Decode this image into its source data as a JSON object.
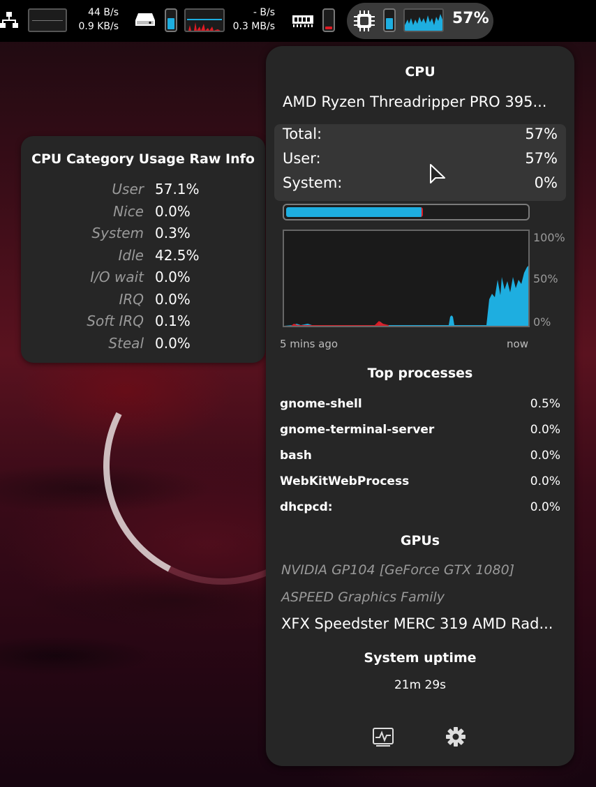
{
  "topbar": {
    "network": {
      "upload": "44  B/s",
      "download": "0.9 KB/s"
    },
    "disk": {
      "read": "- B/s",
      "write": "0.3 MB/s",
      "usage_fraction": 0.6
    },
    "memory": {
      "usage_fraction": 0.15
    },
    "cpu": {
      "percent": "57%",
      "usage_fraction": 0.6
    }
  },
  "raw_info": {
    "title": "CPU Category Usage Raw Info",
    "rows": [
      {
        "key": "User",
        "value": "57.1%"
      },
      {
        "key": "Nice",
        "value": "0.0%"
      },
      {
        "key": "System",
        "value": "0.3%"
      },
      {
        "key": "Idle",
        "value": "42.5%"
      },
      {
        "key": "I/O wait",
        "value": "0.0%"
      },
      {
        "key": "IRQ",
        "value": "0.0%"
      },
      {
        "key": "Soft IRQ",
        "value": "0.1%"
      },
      {
        "key": "Steal",
        "value": "0.0%"
      }
    ]
  },
  "popover": {
    "title": "CPU",
    "cpu_name": "AMD Ryzen Threadripper PRO 395...",
    "stats": [
      {
        "key": "Total:",
        "value": "57%"
      },
      {
        "key": "User:",
        "value": "57%"
      },
      {
        "key": "System:",
        "value": "0%"
      }
    ],
    "usage_fraction": 0.57,
    "graph": {
      "labels": {
        "top": "100%",
        "mid": "50%",
        "bottom": "0%"
      },
      "time_start": "5 mins ago",
      "time_end": "now"
    },
    "top_processes_title": "Top processes",
    "processes": [
      {
        "name": "gnome-shell",
        "percent": "0.5%"
      },
      {
        "name": "gnome-terminal-server",
        "percent": "0.0%"
      },
      {
        "name": "bash",
        "percent": "0.0%"
      },
      {
        "name": "WebKitWebProcess",
        "percent": "0.0%"
      },
      {
        "name": "dhcpcd:",
        "percent": "0.0%"
      }
    ],
    "gpus_title": "GPUs",
    "gpus": [
      "NVIDIA GP104 [GeForce GTX 1080]",
      "ASPEED Graphics Family",
      "XFX Speedster MERC 319 AMD Rad..."
    ],
    "uptime_title": "System uptime",
    "uptime": "21m 29s"
  },
  "colors": {
    "accent_blue": "#1eaee0",
    "accent_red": "#e01b24",
    "panel_bg": "#262626"
  },
  "icons": {
    "network": "network-icon",
    "disk": "disk-icon",
    "memory": "memory-icon",
    "cpu": "cpu-chip-icon",
    "monitor": "system-monitor-icon",
    "settings": "gear-icon"
  }
}
